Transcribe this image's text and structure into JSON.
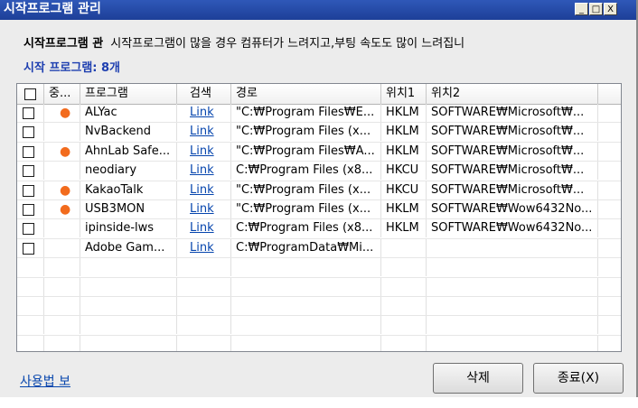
{
  "window": {
    "title": "시작프로그램 관리",
    "controls": [
      "_",
      "□",
      "X"
    ]
  },
  "description": {
    "title": "시작프로그램 관",
    "text": "시작프로그램이 많을 경우 컴퓨터가 느려지고,부팅 속도도 많이 느려집니"
  },
  "count_label": "시작 프로그램: 8개",
  "table": {
    "columns": [
      "중...",
      "프로그램",
      "검색",
      "경로",
      "위치1",
      "위치2"
    ],
    "rows": [
      {
        "important": "●",
        "program": "ALYac",
        "search": "Link",
        "path": "\"C:₩Program Files₩E...",
        "loc1": "HKLM",
        "loc2": "SOFTWARE₩Microsoft₩..."
      },
      {
        "important": "",
        "program": "NvBackend",
        "search": "Link",
        "path": "\"C:₩Program Files (x...",
        "loc1": "HKLM",
        "loc2": "SOFTWARE₩Microsoft₩..."
      },
      {
        "important": "●",
        "program": "AhnLab Safe...",
        "search": "Link",
        "path": "\"C:₩Program Files₩A...",
        "loc1": "HKLM",
        "loc2": "SOFTWARE₩Microsoft₩..."
      },
      {
        "important": "",
        "program": "neodiary",
        "search": "Link",
        "path": "C:₩Program Files (x8...",
        "loc1": "HKCU",
        "loc2": "SOFTWARE₩Microsoft₩..."
      },
      {
        "important": "●",
        "program": "KakaoTalk",
        "search": "Link",
        "path": "\"C:₩Program Files (x...",
        "loc1": "HKCU",
        "loc2": "SOFTWARE₩Microsoft₩..."
      },
      {
        "important": "●",
        "program": "USB3MON",
        "search": "Link",
        "path": "\"C:₩Program Files (x...",
        "loc1": "HKLM",
        "loc2": "SOFTWARE₩Wow6432No..."
      },
      {
        "important": "",
        "program": "ipinside-lws",
        "search": "Link",
        "path": "C:₩Program Files (x8...",
        "loc1": "HKLM",
        "loc2": "SOFTWARE₩Wow6432No..."
      },
      {
        "important": "",
        "program": "Adobe Gam...",
        "search": "Link",
        "path": "C:₩ProgramData₩Mi...",
        "loc1": "",
        "loc2": ""
      }
    ]
  },
  "footer": {
    "help_link": "사용법 보",
    "delete_button": "삭제",
    "close_button": "종료(X)"
  },
  "colors": {
    "titlebar": "#1d3f98",
    "accent_text": "#1e3fb0",
    "dot": "#f26b1d",
    "link": "#0645ad"
  }
}
